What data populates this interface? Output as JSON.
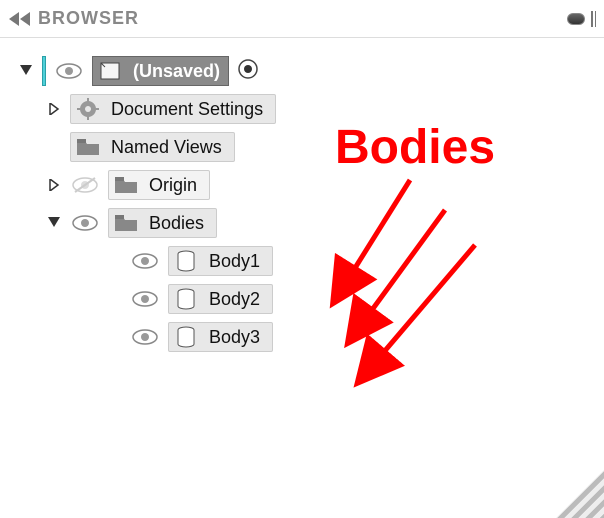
{
  "header": {
    "title": "BROWSER"
  },
  "tree": {
    "root": {
      "label": "(Unsaved)"
    },
    "items": [
      {
        "label": "Document Settings",
        "icon": "gear",
        "expanded": false,
        "hasEye": false
      },
      {
        "label": "Named Views",
        "icon": "folder",
        "expanded": null,
        "hasEye": false
      },
      {
        "label": "Origin",
        "icon": "folder",
        "expanded": false,
        "hasEye": "hidden"
      },
      {
        "label": "Bodies",
        "icon": "folder",
        "expanded": true,
        "hasEye": true
      }
    ],
    "bodies": [
      {
        "label": "Body1"
      },
      {
        "label": "Body2"
      },
      {
        "label": "Body3"
      }
    ]
  },
  "annotation": {
    "text": "Bodies",
    "color": "#ff0000"
  }
}
